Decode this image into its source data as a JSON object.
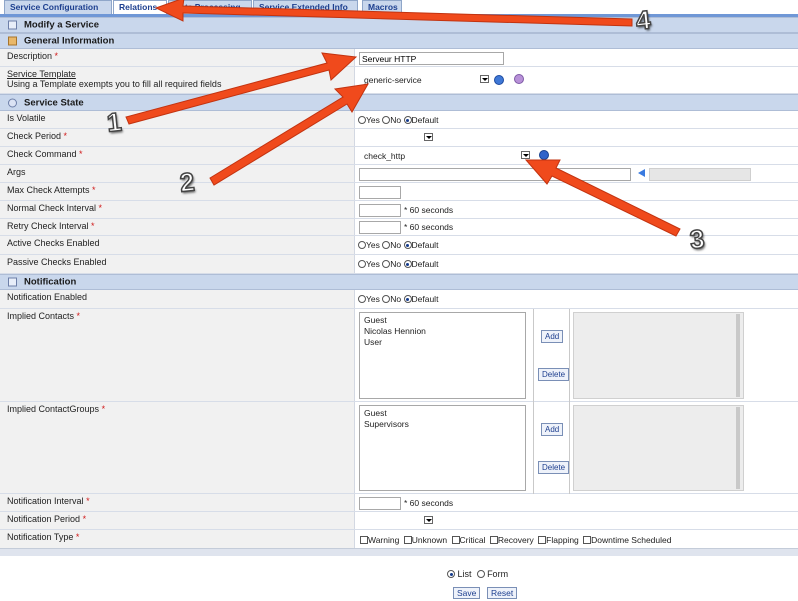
{
  "tabs": [
    {
      "label": "Service Configuration"
    },
    {
      "label": "Relations"
    },
    {
      "label": "Data Processing"
    },
    {
      "label": "Service Extended Info"
    },
    {
      "label": "Macros"
    }
  ],
  "page_title": "Modify a Service",
  "sections": {
    "general": "General Information",
    "state": "Service State",
    "notification": "Notification"
  },
  "general": {
    "description_label": "Description",
    "description_value": "Serveur HTTP",
    "template_label": "Service Template",
    "template_hint": "Using a Template exempts you to fill all required fields",
    "template_value": "generic-service"
  },
  "state": {
    "is_volatile_label": "Is Volatile",
    "check_period_label": "Check Period",
    "check_command_label": "Check Command",
    "check_command_value": "check_http",
    "args_label": "Args",
    "max_attempts_label": "Max Check Attempts",
    "normal_interval_label": "Normal Check Interval",
    "retry_interval_label": "Retry Check Interval",
    "active_checks_label": "Active Checks Enabled",
    "passive_checks_label": "Passive Checks Enabled",
    "seconds_suffix": "* 60 seconds"
  },
  "radio": {
    "yes": "Yes",
    "no": "No",
    "default": "Default"
  },
  "notification": {
    "enabled_label": "Notification Enabled",
    "contacts_label": "Implied Contacts",
    "contacts": [
      "Guest",
      "Nicolas Hennion",
      "User"
    ],
    "contactgroups_label": "Implied ContactGroups",
    "contactgroups": [
      "Guest",
      "Supervisors"
    ],
    "add_label": "Add",
    "delete_label": "Delete",
    "interval_label": "Notification Interval",
    "period_label": "Notification Period",
    "type_label": "Notification Type",
    "types": [
      "Warning",
      "Unknown",
      "Critical",
      "Recovery",
      "Flapping",
      "Downtime Scheduled"
    ]
  },
  "footer": {
    "list_label": "List",
    "form_label": "Form",
    "save_label": "Save",
    "reset_label": "Reset"
  },
  "annotations": [
    "1",
    "2",
    "3",
    "4"
  ],
  "colors": {
    "arrow": "#f04a1c",
    "tab_bg": "#c9d7ec",
    "section_bg": "#c9d7ec",
    "link": "#1e3f8f"
  }
}
